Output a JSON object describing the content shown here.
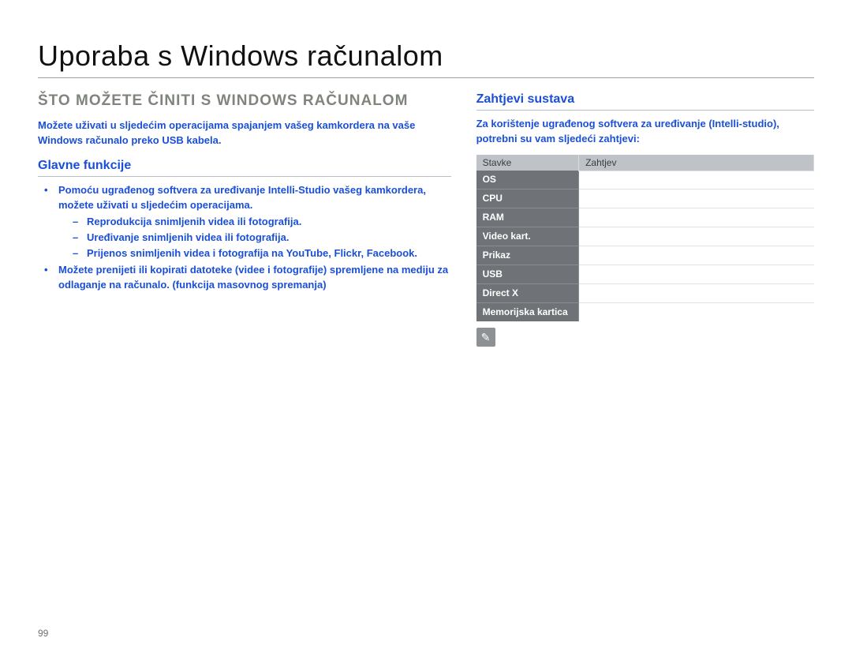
{
  "title": "Uporaba s Windows računalom",
  "left": {
    "heading": "ŠTO MOŽETE ČINITI S WINDOWS RAČUNALOM",
    "intro": "Možete uživati u sljedećim operacijama spajanjem vašeg kamkordera na vaše Windows računalo preko USB kabela.",
    "section_title": "Glavne funkcije",
    "b1_lead": "Pomoću ugrađenog softvera za uređivanje Intelli-Studio vašeg kamkordera, možete uživati u sljedećim operacijama.",
    "s1": "Reprodukcija snimljenih videa ili fotografija.",
    "s2": "Uređivanje snimljenih videa ili fotografija.",
    "s3": "Prijenos snimljenih videa i fotografija na YouTube, Flickr, Facebook.",
    "b2": "Možete prenijeti ili kopirati datoteke (videe i fotografije) spremljene na mediju za odlaganje na računalo. (funkcija masovnog spremanja)"
  },
  "right": {
    "section_title": "Zahtjevi sustava",
    "intro": "Za korištenje ugrađenog softvera za uređivanje (Intelli-studio), potrebni su vam sljedeći zahtjevi:",
    "th1": "Stavke",
    "th2": "Zahtjev",
    "rows": [
      {
        "k": "OS",
        "v": ""
      },
      {
        "k": "CPU",
        "v": ""
      },
      {
        "k": "RAM",
        "v": ""
      },
      {
        "k": "Video kart.",
        "v": ""
      },
      {
        "k": "Prikaz",
        "v": ""
      },
      {
        "k": "USB",
        "v": ""
      },
      {
        "k": "Direct X",
        "v": ""
      },
      {
        "k": "Memorijska kartica",
        "v": ""
      }
    ]
  },
  "note_glyph": "✎",
  "page_number": "99"
}
